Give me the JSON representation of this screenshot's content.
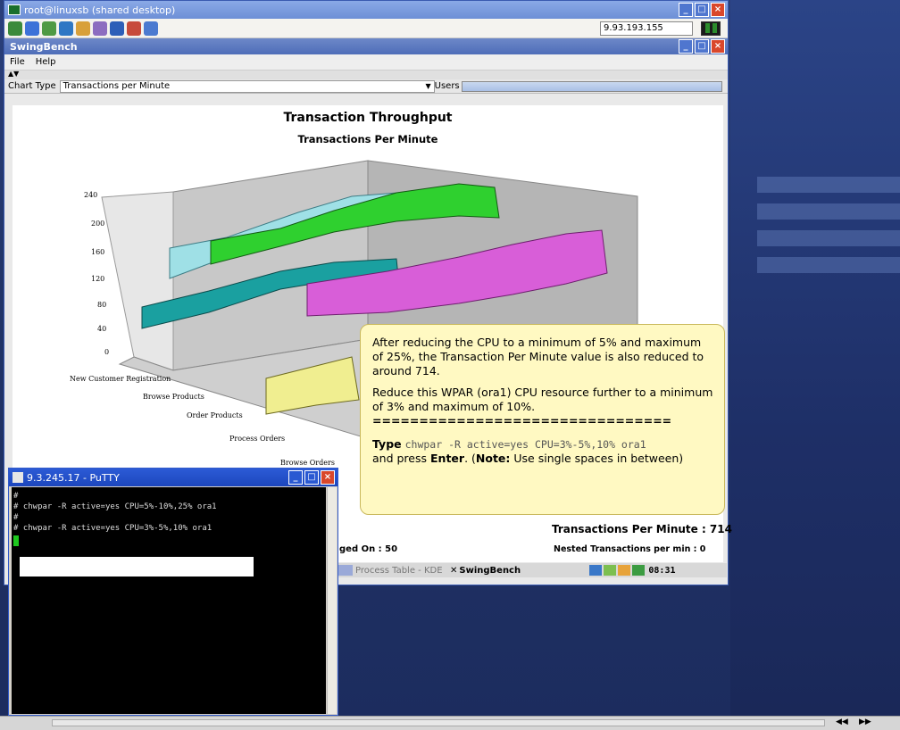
{
  "remote_window": {
    "title": "root@linuxsb (shared desktop)",
    "ip_address": "9.93.193.155"
  },
  "swingbench": {
    "title": "SwingBench",
    "menu": [
      "File",
      "Help"
    ],
    "chart_type_label": "Chart Type",
    "chart_type_value": "Transactions per Minute",
    "users_label": "Users",
    "status_tpm": "Transactions Per Minute : 714",
    "status_logged": "ged On : 50",
    "status_nested": "Nested Transactions per min : 0"
  },
  "chart_data": {
    "type": "area",
    "title": "Transaction Throughput",
    "subtitle": "Transactions Per Minute",
    "yticks": [
      "0",
      "40",
      "80",
      "120",
      "160",
      "200",
      "240"
    ],
    "categories": [
      "New Customer Registration",
      "Browse Products",
      "Order Products",
      "Process Orders",
      "Browse Orders"
    ],
    "ylim": [
      0,
      240
    ]
  },
  "taskbar": {
    "item1": "Process Table - KDE",
    "item2": "SwingBench",
    "clock": "08:31"
  },
  "putty": {
    "title": "9.3.245.17 - PuTTY",
    "lines": [
      "#",
      "# chwpar -R active=yes CPU=5%-10%,25% ora1",
      "#",
      "# chwpar -R active=yes CPU=3%-5%,10% ora1"
    ]
  },
  "callout": {
    "p1": "After reducing the CPU to a minimum of 5% and maximum of 25%, the Transaction Per Minute value is also reduced to around 714.",
    "p2": "Reduce this WPAR (ora1) CPU resource further to a minimum of 3% and maximum of 10%.",
    "separator": "================================",
    "type_word": "Type",
    "command": "chwpar -R active=yes CPU=3%-5%,10% ora1",
    "and_press": "and press",
    "enter": "Enter",
    "note_open": ". (",
    "note_label": "Note:",
    "note_text": " Use single spaces in between)"
  }
}
